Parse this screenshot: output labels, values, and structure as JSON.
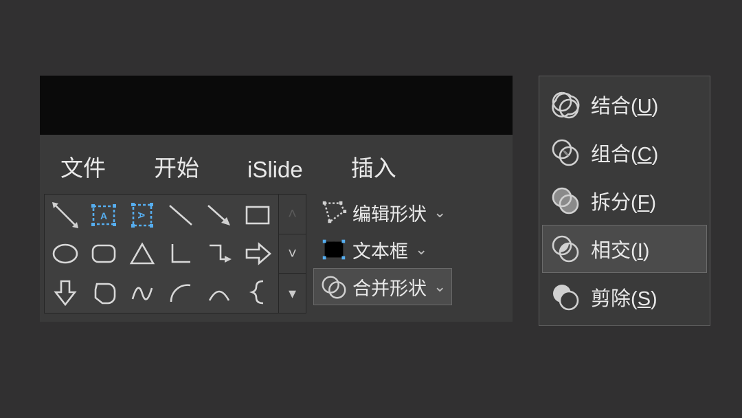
{
  "ribbon": {
    "tabs": [
      "文件",
      "开始",
      "iSlide",
      "插入"
    ],
    "shapes_gallery": [
      "line-diag",
      "textbox-h",
      "textbox-v",
      "line",
      "arrow-line",
      "rect",
      "ellipse",
      "round-rect",
      "triangle",
      "right-angle",
      "elbow",
      "arrow-block",
      "arrow-down",
      "blob",
      "freeform",
      "arc",
      "caret",
      "brace-left"
    ],
    "scroll": {
      "up": "˄",
      "down": "˅",
      "more": "▾"
    },
    "commands": {
      "edit_shape": "编辑形状",
      "text_box": "文本框",
      "merge": "合并形状"
    }
  },
  "merge_menu": {
    "items": [
      {
        "id": "union",
        "label": "结合",
        "key": "U",
        "selected": false
      },
      {
        "id": "combine",
        "label": "组合",
        "key": "C",
        "selected": false
      },
      {
        "id": "fragment",
        "label": "拆分",
        "key": "F",
        "selected": false
      },
      {
        "id": "intersect",
        "label": "相交",
        "key": "I",
        "selected": true
      },
      {
        "id": "subtract",
        "label": "剪除",
        "key": "S",
        "selected": false
      }
    ]
  }
}
